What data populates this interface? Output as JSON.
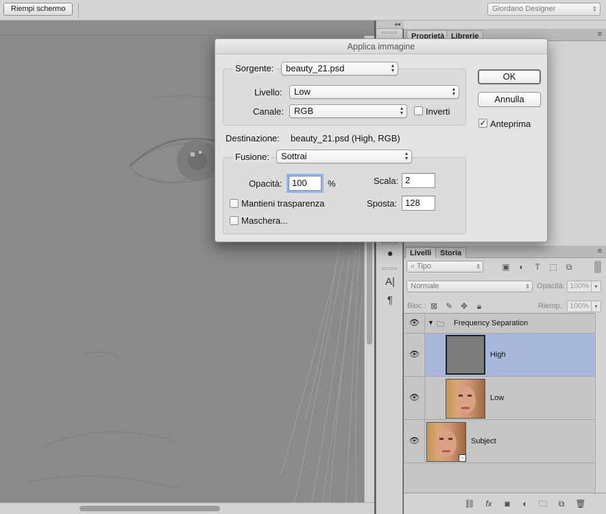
{
  "optionsbar": {
    "fill_screen_button": "Riempi schermo",
    "workspace": "Giordano Designer"
  },
  "panel_collapse": {
    "left": "◂◂",
    "right": "▸▸"
  },
  "properties_tabs": [
    "Proprietà",
    "Librerie"
  ],
  "layers_panel": {
    "tabs": [
      "Livelli",
      "Storia"
    ],
    "filter_kind": "Tipo",
    "blend_mode": "Normale",
    "opacity_label": "Opacità:",
    "opacity_value": "100%",
    "lock_label": "Bloc.:",
    "fill_label": "Riemp.:",
    "fill_value": "100%",
    "group_name": "Frequency Separation",
    "layers": [
      {
        "name": "High",
        "selected": true
      },
      {
        "name": "Low",
        "selected": false
      },
      {
        "name": "Subject",
        "selected": false
      }
    ]
  },
  "dialog": {
    "title": "Applica immagine",
    "source_label": "Sorgente:",
    "source_value": "beauty_21.psd",
    "layer_label": "Livello:",
    "layer_value": "Low",
    "channel_label": "Canale:",
    "channel_value": "RGB",
    "invert_label": "Inverti",
    "invert_checked": false,
    "destination_label": "Destinazione:",
    "destination_value": "beauty_21.psd (High, RGB)",
    "blending_label": "Fusione:",
    "blending_value": "Sottrai",
    "opacity_label": "Opacità:",
    "opacity_value": "100",
    "opacity_unit": "%",
    "scale_label": "Scala:",
    "scale_value": "2",
    "offset_label": "Sposta:",
    "offset_value": "128",
    "preserve_transparency_label": "Mantieni trasparenza",
    "preserve_transparency_checked": false,
    "mask_label": "Maschera...",
    "mask_checked": false,
    "ok_label": "OK",
    "cancel_label": "Annulla",
    "preview_label": "Anteprima",
    "preview_checked": true
  },
  "icons": {
    "eye": "eye-icon",
    "folder": "folder-icon",
    "link": "link-icon",
    "fx": "fx-icon",
    "mask": "add-mask-icon",
    "adjustment": "adjustment-icon",
    "new_group": "new-group-icon",
    "new_layer": "new-layer-icon",
    "trash": "trash-icon"
  }
}
